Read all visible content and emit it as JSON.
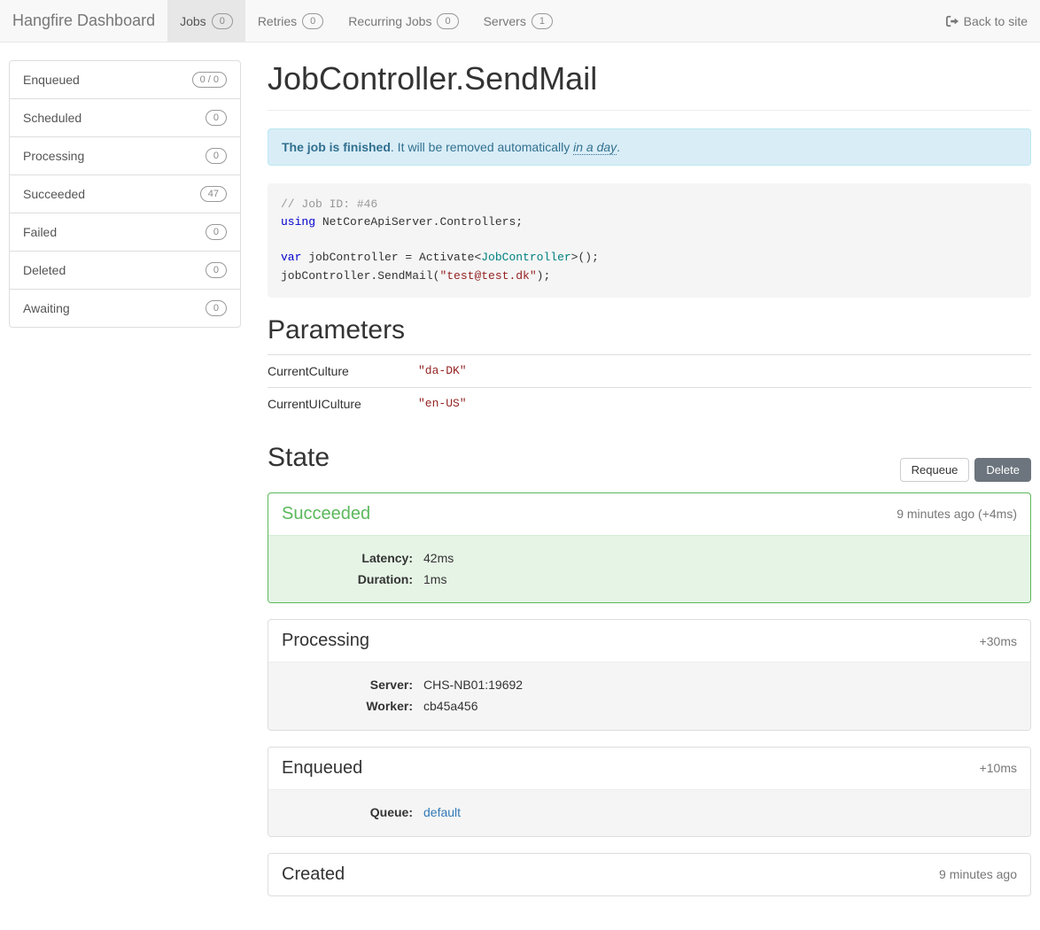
{
  "navbar": {
    "brand": "Hangfire Dashboard",
    "items": [
      {
        "label": "Jobs",
        "count": "0",
        "active": true
      },
      {
        "label": "Retries",
        "count": "0",
        "active": false
      },
      {
        "label": "Recurring Jobs",
        "count": "0",
        "active": false
      },
      {
        "label": "Servers",
        "count": "1",
        "active": false
      }
    ],
    "back": "Back to site"
  },
  "sidebar": {
    "items": [
      {
        "label": "Enqueued",
        "count": "0 / 0"
      },
      {
        "label": "Scheduled",
        "count": "0"
      },
      {
        "label": "Processing",
        "count": "0"
      },
      {
        "label": "Succeeded",
        "count": "47"
      },
      {
        "label": "Failed",
        "count": "0"
      },
      {
        "label": "Deleted",
        "count": "0"
      },
      {
        "label": "Awaiting",
        "count": "0"
      }
    ]
  },
  "page": {
    "title": "JobController.SendMail"
  },
  "alert": {
    "strong": "The job is finished",
    "middle": ". It will be removed automatically ",
    "time": "in a day",
    "end": "."
  },
  "code": {
    "comment": "// Job ID: #46",
    "kw_using": "using",
    "ns": " NetCoreApiServer.Controllers;",
    "kw_var": "var",
    "decl": " jobController = Activate<",
    "type": "JobController",
    "decl_end": ">();",
    "call_pre": "jobController.SendMail(",
    "arg": "\"test@test.dk\"",
    "call_post": ");"
  },
  "parameters": {
    "heading": "Parameters",
    "rows": [
      {
        "key": "CurrentCulture",
        "value": "\"da-DK\""
      },
      {
        "key": "CurrentUICulture",
        "value": "\"en-US\""
      }
    ]
  },
  "state": {
    "heading": "State",
    "requeue": "Requeue",
    "delete": "Delete",
    "items": [
      {
        "name": "Succeeded",
        "time": "9 minutes ago (+4ms)",
        "success": true,
        "details": [
          {
            "key": "Latency:",
            "value": "42ms"
          },
          {
            "key": "Duration:",
            "value": "1ms"
          }
        ]
      },
      {
        "name": "Processing",
        "time": "+30ms",
        "details": [
          {
            "key": "Server:",
            "value": "CHS-NB01:19692"
          },
          {
            "key": "Worker:",
            "value": "cb45a456"
          }
        ]
      },
      {
        "name": "Enqueued",
        "time": "+10ms",
        "details": [
          {
            "key": "Queue:",
            "value": "default",
            "link": true
          }
        ]
      },
      {
        "name": "Created",
        "time": "9 minutes ago"
      }
    ]
  }
}
